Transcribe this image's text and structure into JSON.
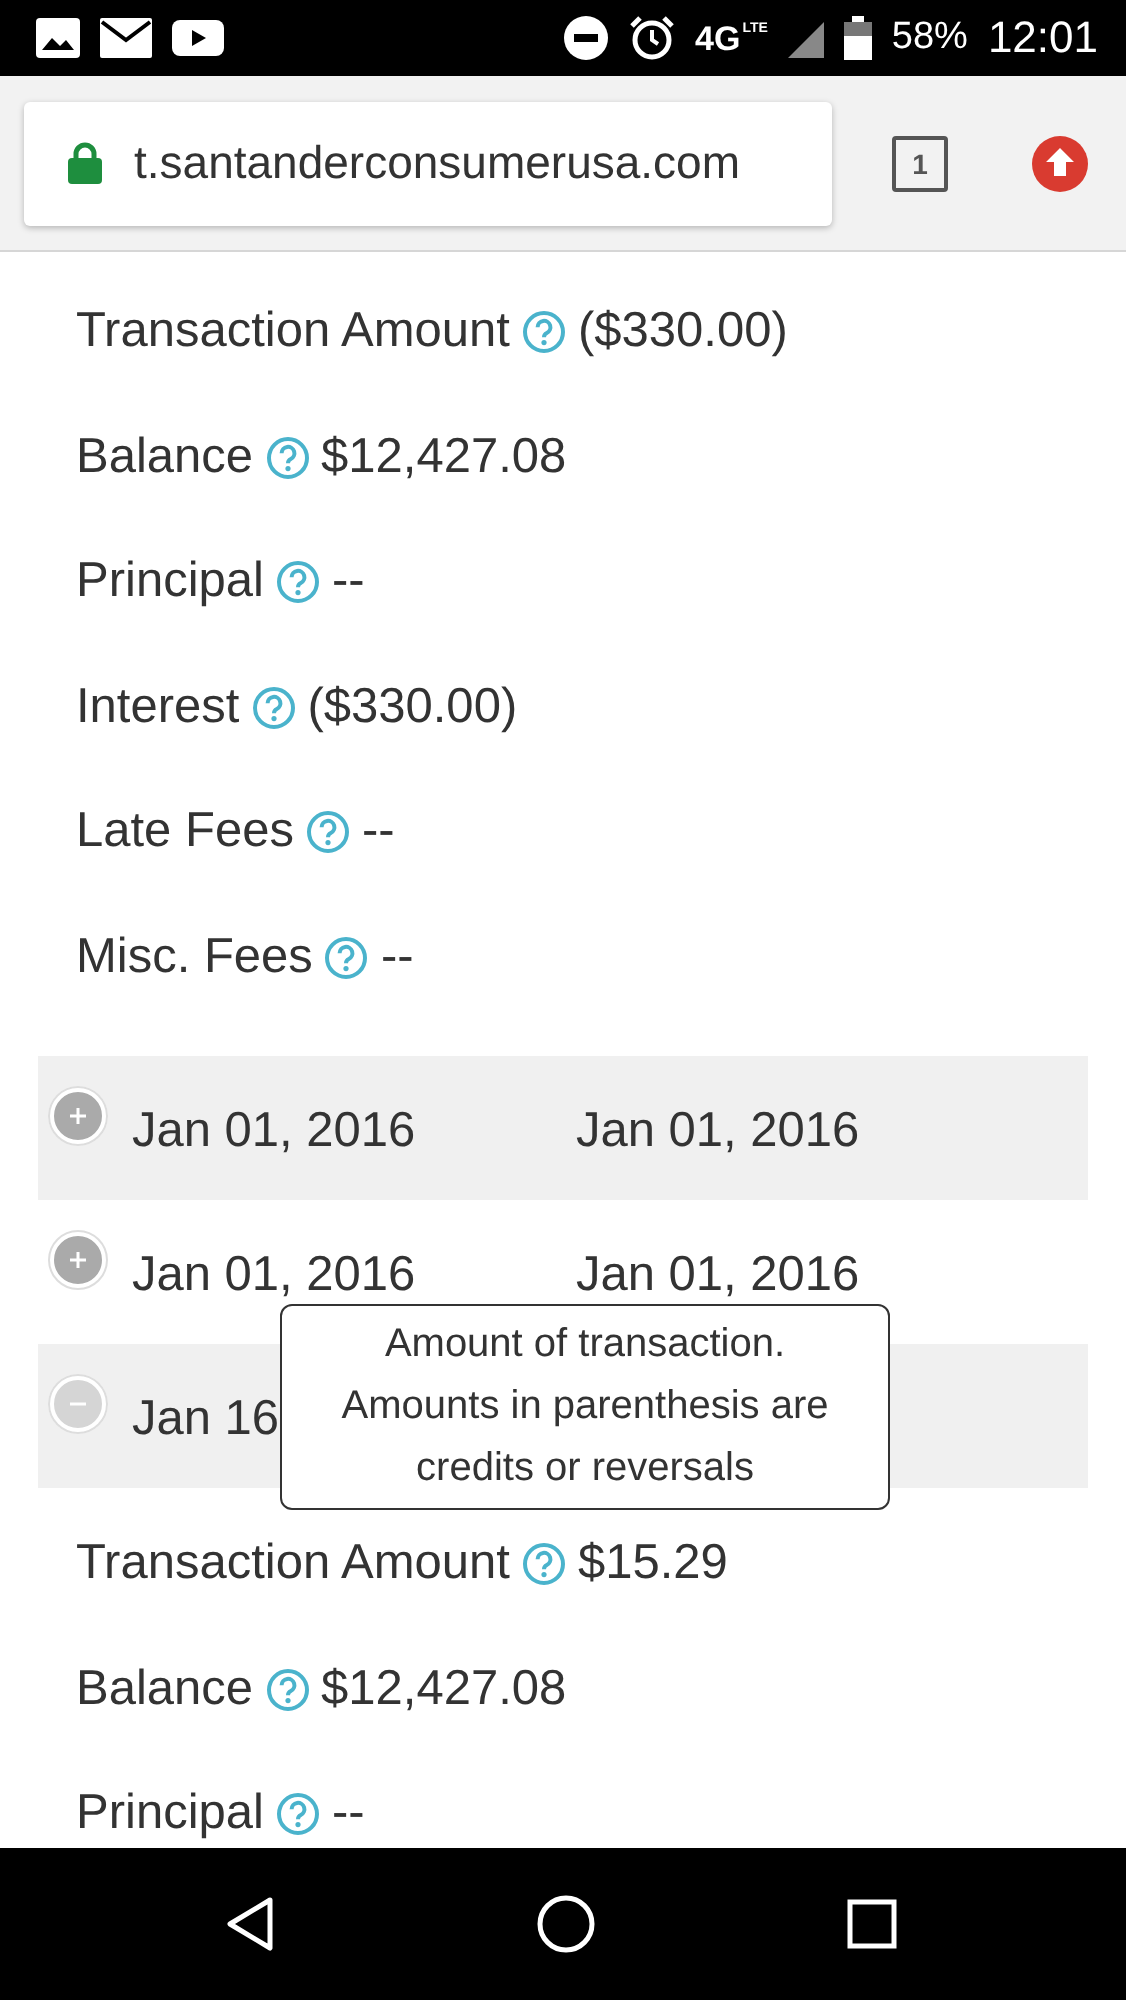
{
  "status_bar": {
    "network": "4G",
    "network_sub": "LTE",
    "battery": "58%",
    "time": "12:01"
  },
  "browser": {
    "url": "t.santanderconsumerusa.com",
    "tab_count": "1"
  },
  "details_top": [
    {
      "label": "Transaction Amount",
      "value": "($330.00)"
    },
    {
      "label": "Balance",
      "value": "$12,427.08"
    },
    {
      "label": "Principal",
      "value": "--"
    },
    {
      "label": "Interest",
      "value": "($330.00)"
    },
    {
      "label": "Late Fees",
      "value": "--"
    },
    {
      "label": "Misc. Fees",
      "value": "--"
    }
  ],
  "transactions": [
    {
      "date_1": "Jan 01, 2016",
      "date_2": "Jan 01, 2016",
      "expanded": false
    },
    {
      "date_1": "Jan 01, 2016",
      "date_2": "Jan 01, 2016",
      "expanded": false
    },
    {
      "date_1": "Jan 16",
      "expanded": true
    }
  ],
  "tooltip": "Amount of transaction. Amounts in parenthesis are credits or reversals",
  "details_expanded": [
    {
      "label": "Transaction Amount",
      "value": "$15.29"
    },
    {
      "label": "Balance",
      "value": "$12,427.08"
    },
    {
      "label": "Principal",
      "value": "--"
    }
  ]
}
